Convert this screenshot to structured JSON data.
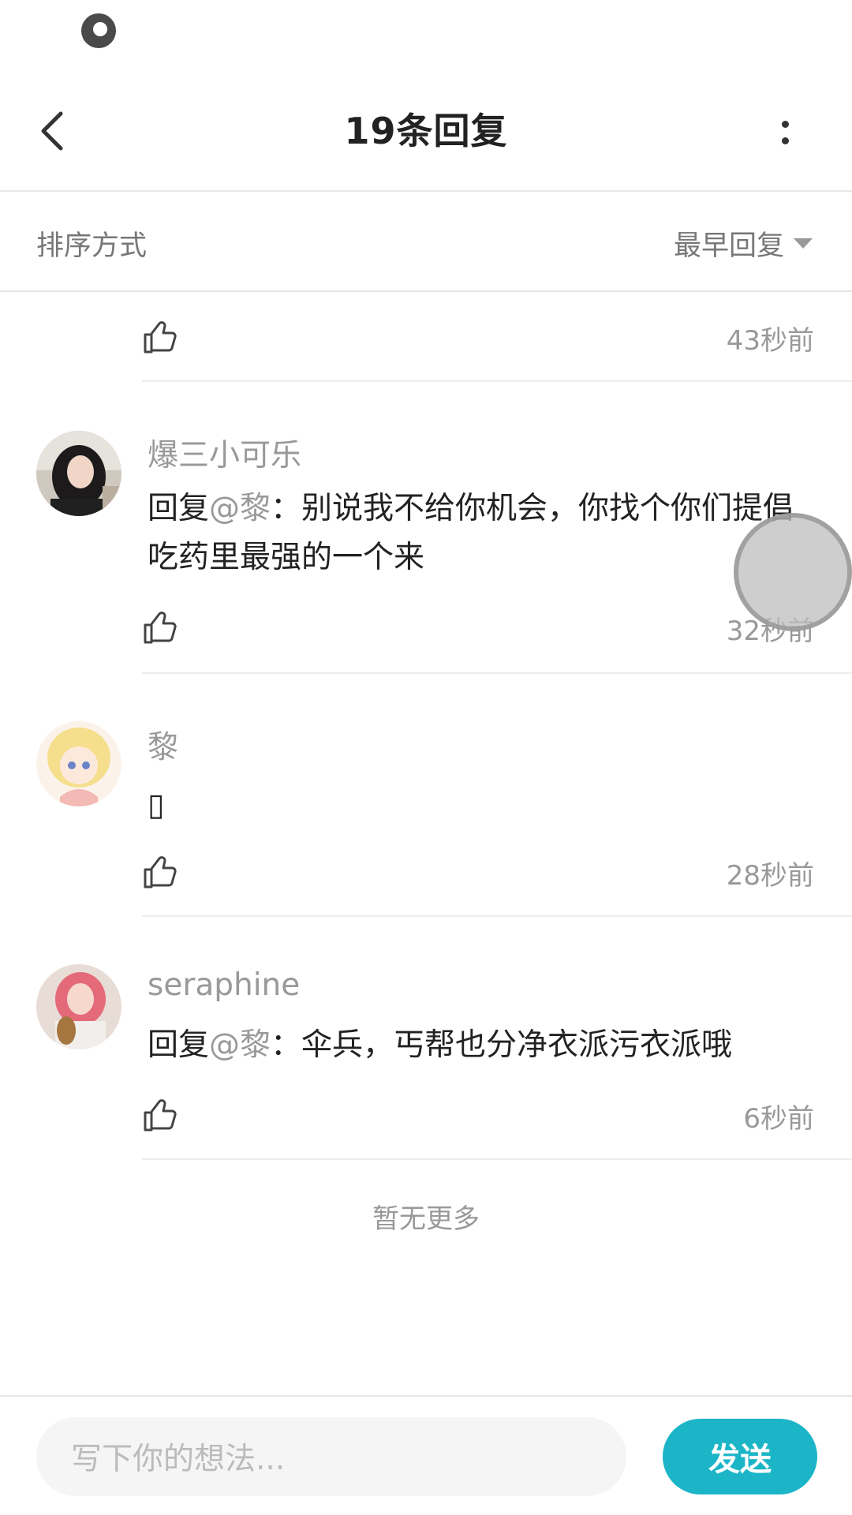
{
  "header": {
    "title": "19条回复"
  },
  "sort": {
    "label": "排序方式",
    "selected": "最早回复"
  },
  "top_partial": {
    "time": "43秒前"
  },
  "comments": [
    {
      "username": "爆三小可乐",
      "reply_prefix": "回复",
      "mention": "@黎",
      "text": "：别说我不给你机会，你找个你们提倡吃药里最强的一个来",
      "time": "32秒前"
    },
    {
      "username": "黎",
      "text": "▯",
      "time": "28秒前"
    },
    {
      "username": "seraphine",
      "reply_prefix": "回复",
      "mention": "@黎",
      "text": "：伞兵，丐帮也分净衣派污衣派哦",
      "time": "6秒前"
    }
  ],
  "footer": {
    "no_more": "暂无更多"
  },
  "composer": {
    "placeholder": "写下你的想法...",
    "send_label": "发送"
  },
  "colors": {
    "accent": "#1cb5c8",
    "muted_text": "#999999"
  }
}
